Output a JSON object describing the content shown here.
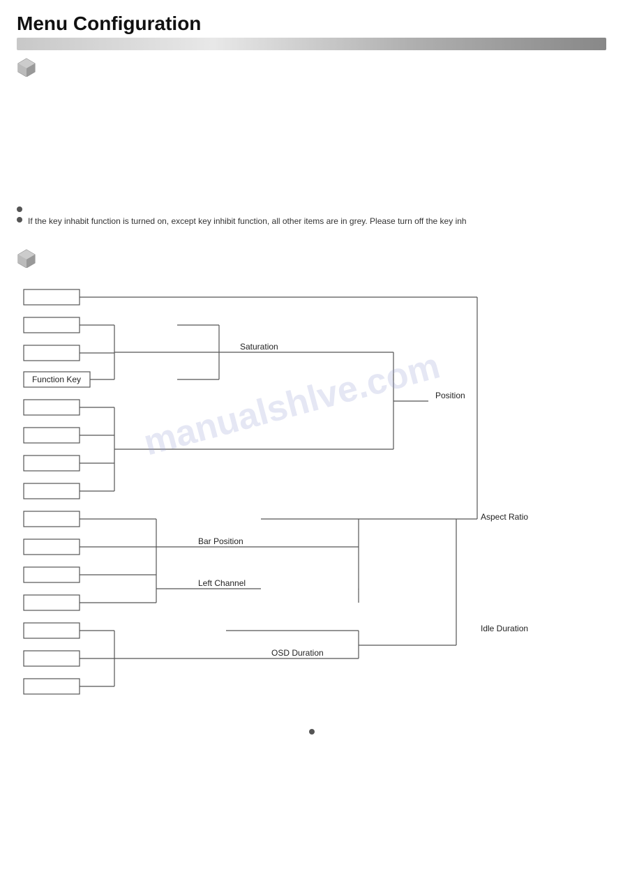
{
  "header": {
    "title": "Menu Configuration"
  },
  "notes": {
    "bullet1": "",
    "bullet2": "If the key inhabit function is turned on, except key inhibit function, all other items are in grey. Please turn off the key inh"
  },
  "diagram": {
    "labels": {
      "saturation": "Saturation",
      "function_key": "Function Key",
      "position": "Position",
      "bar_position": "Bar Position",
      "left_channel": "Left Channel",
      "osd_duration": "OSD Duration",
      "aspect_ratio": "Aspect Ratio",
      "idle_duration": "Idle Duration"
    }
  },
  "watermark": "manualshlve.com"
}
